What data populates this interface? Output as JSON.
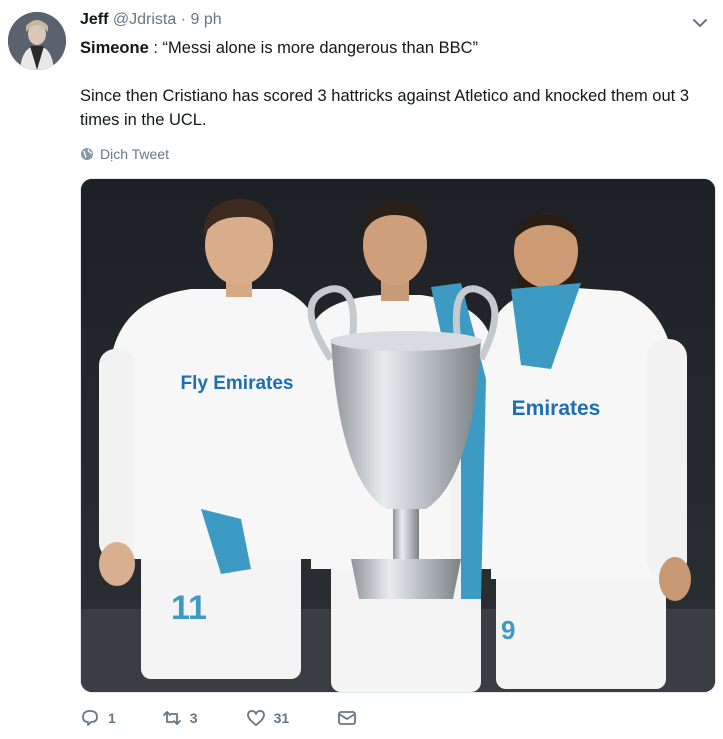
{
  "tweet": {
    "author_name": "Jeff",
    "handle": "@Jdrista",
    "separator": "·",
    "time": "9 ph",
    "speaker": "Simeone",
    "quote": " : “Messi alone is more dangerous than BBC”",
    "body": "Since then Cristiano has scored 3 hattricks against Atletico and knocked them out 3 times in the UCL.",
    "translate_label": "Dịch Tweet"
  },
  "media": {
    "sponsor_left": "Fly Emirates",
    "sponsor_right": "Emirates",
    "number_left": "11",
    "number_right": "9"
  },
  "actions": {
    "reply_count": "1",
    "retweet_count": "3",
    "like_count": "31"
  },
  "icons": {
    "caret": "chevron-down-icon",
    "translate": "globe-icon",
    "reply": "reply-icon",
    "retweet": "retweet-icon",
    "like": "heart-icon",
    "message": "envelope-icon"
  },
  "colors": {
    "text": "#14171a",
    "muted": "#657786",
    "border": "#e1e8ed",
    "scarf": "#3d9bc3"
  }
}
